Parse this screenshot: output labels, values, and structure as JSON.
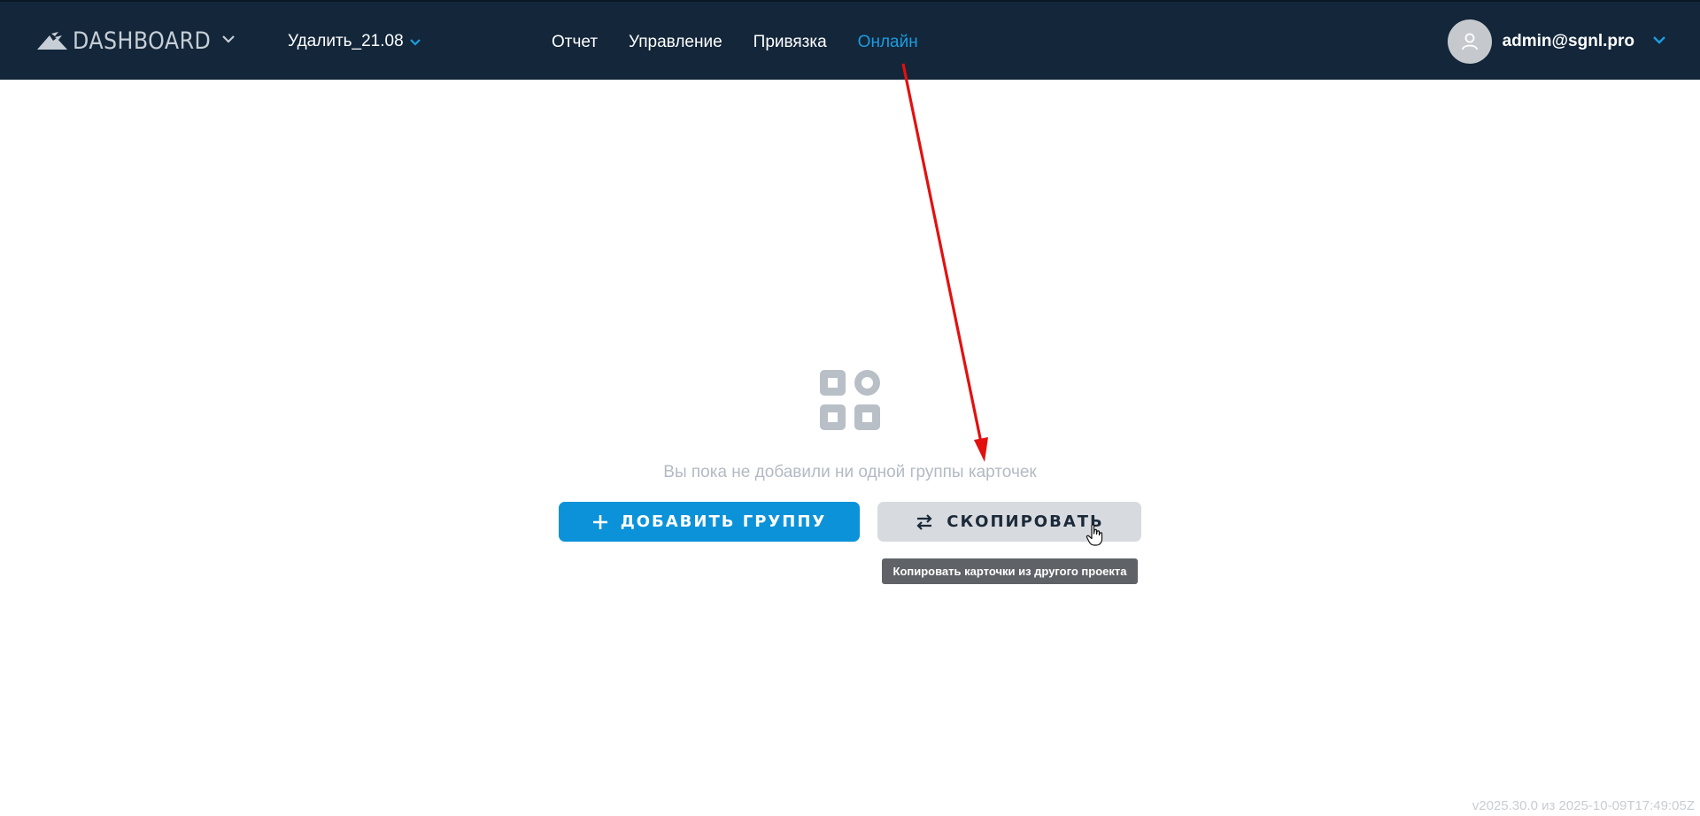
{
  "header": {
    "logo_text": "DASHBOARD",
    "project_name": "Удалить_21.08",
    "nav": [
      {
        "label": "Отчет",
        "active": false
      },
      {
        "label": "Управление",
        "active": false
      },
      {
        "label": "Привязка",
        "active": false
      },
      {
        "label": "Онлайн",
        "active": true
      }
    ],
    "user_email": "admin@sgnl.pro",
    "colors": {
      "background": "#13263a",
      "active_nav": "#1e9ce0"
    }
  },
  "empty_state": {
    "icon": "cards-grid-icon",
    "message": "Вы пока не добавили ни одной группы карточек",
    "add_button_label": "ДОБАВИТЬ ГРУППУ",
    "copy_button_label": "СКОПИРОВАТЬ",
    "copy_tooltip": "Копировать карточки из другого проекта"
  },
  "footer": {
    "version": "v2025.30.0 из 2025-10-09T17:49:05Z"
  },
  "annotation": {
    "color": "#e31010"
  }
}
